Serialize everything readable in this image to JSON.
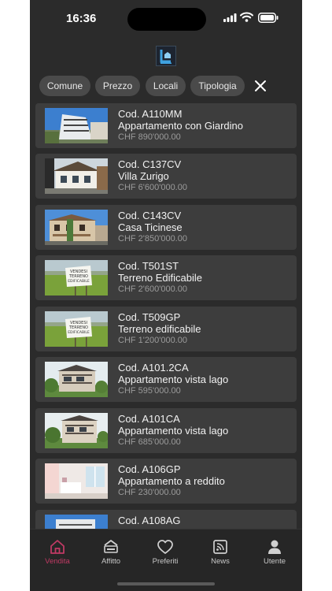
{
  "status": {
    "time": "16:36"
  },
  "filters": [
    "Comune",
    "Prezzo",
    "Locali",
    "Tipologia"
  ],
  "listings": [
    {
      "code": "Cod. A110MM",
      "title": "Appartamento con Giardino",
      "price": "CHF 890'000.00",
      "image": "apartment-building"
    },
    {
      "code": "Cod. C137CV",
      "title": "Villa Zurigo",
      "price": "CHF 6'600'000.00",
      "image": "villa"
    },
    {
      "code": "Cod. C143CV",
      "title": "Casa Ticinese",
      "price": "CHF 2'850'000.00",
      "image": "house"
    },
    {
      "code": "Cod. T501ST",
      "title": "Terreno Edificabile",
      "price": "CHF 2'600'000.00",
      "image": "land-sign",
      "sign": [
        "VENDESI",
        "TERRENO",
        "EDIFICABILE"
      ]
    },
    {
      "code": "Cod. T509GP",
      "title": "Terreno edificabile",
      "price": "CHF 1'200'000.00",
      "image": "land-sign",
      "sign": [
        "VENDESI",
        "TERRENO",
        "EDIFICABILE"
      ]
    },
    {
      "code": "Cod. A101.2CA",
      "title": "Appartamento vista lago",
      "price": "CHF 595'000.00",
      "image": "modern-building"
    },
    {
      "code": "Cod. A101CA",
      "title": "Appartamento vista lago",
      "price": "CHF 685'000.00",
      "image": "modern-building"
    },
    {
      "code": "Cod. A106GP",
      "title": "Appartamento a reddito",
      "price": "CHF 230'000.00",
      "image": "interior"
    },
    {
      "code": "Cod. A108AG",
      "title": "",
      "price": "",
      "image": "apartment-building"
    }
  ],
  "tabs": [
    {
      "label": "Vendita",
      "icon": "house-icon"
    },
    {
      "label": "Affitto",
      "icon": "rent-sign-icon"
    },
    {
      "label": "Preferiti",
      "icon": "heart-icon"
    },
    {
      "label": "News",
      "icon": "news-icon"
    },
    {
      "label": "Utente",
      "icon": "user-icon"
    }
  ],
  "colors": {
    "background": "#2b2b2b",
    "card": "#3d3d3d",
    "chip": "#4a4a4a",
    "accent": "#c03a64"
  }
}
